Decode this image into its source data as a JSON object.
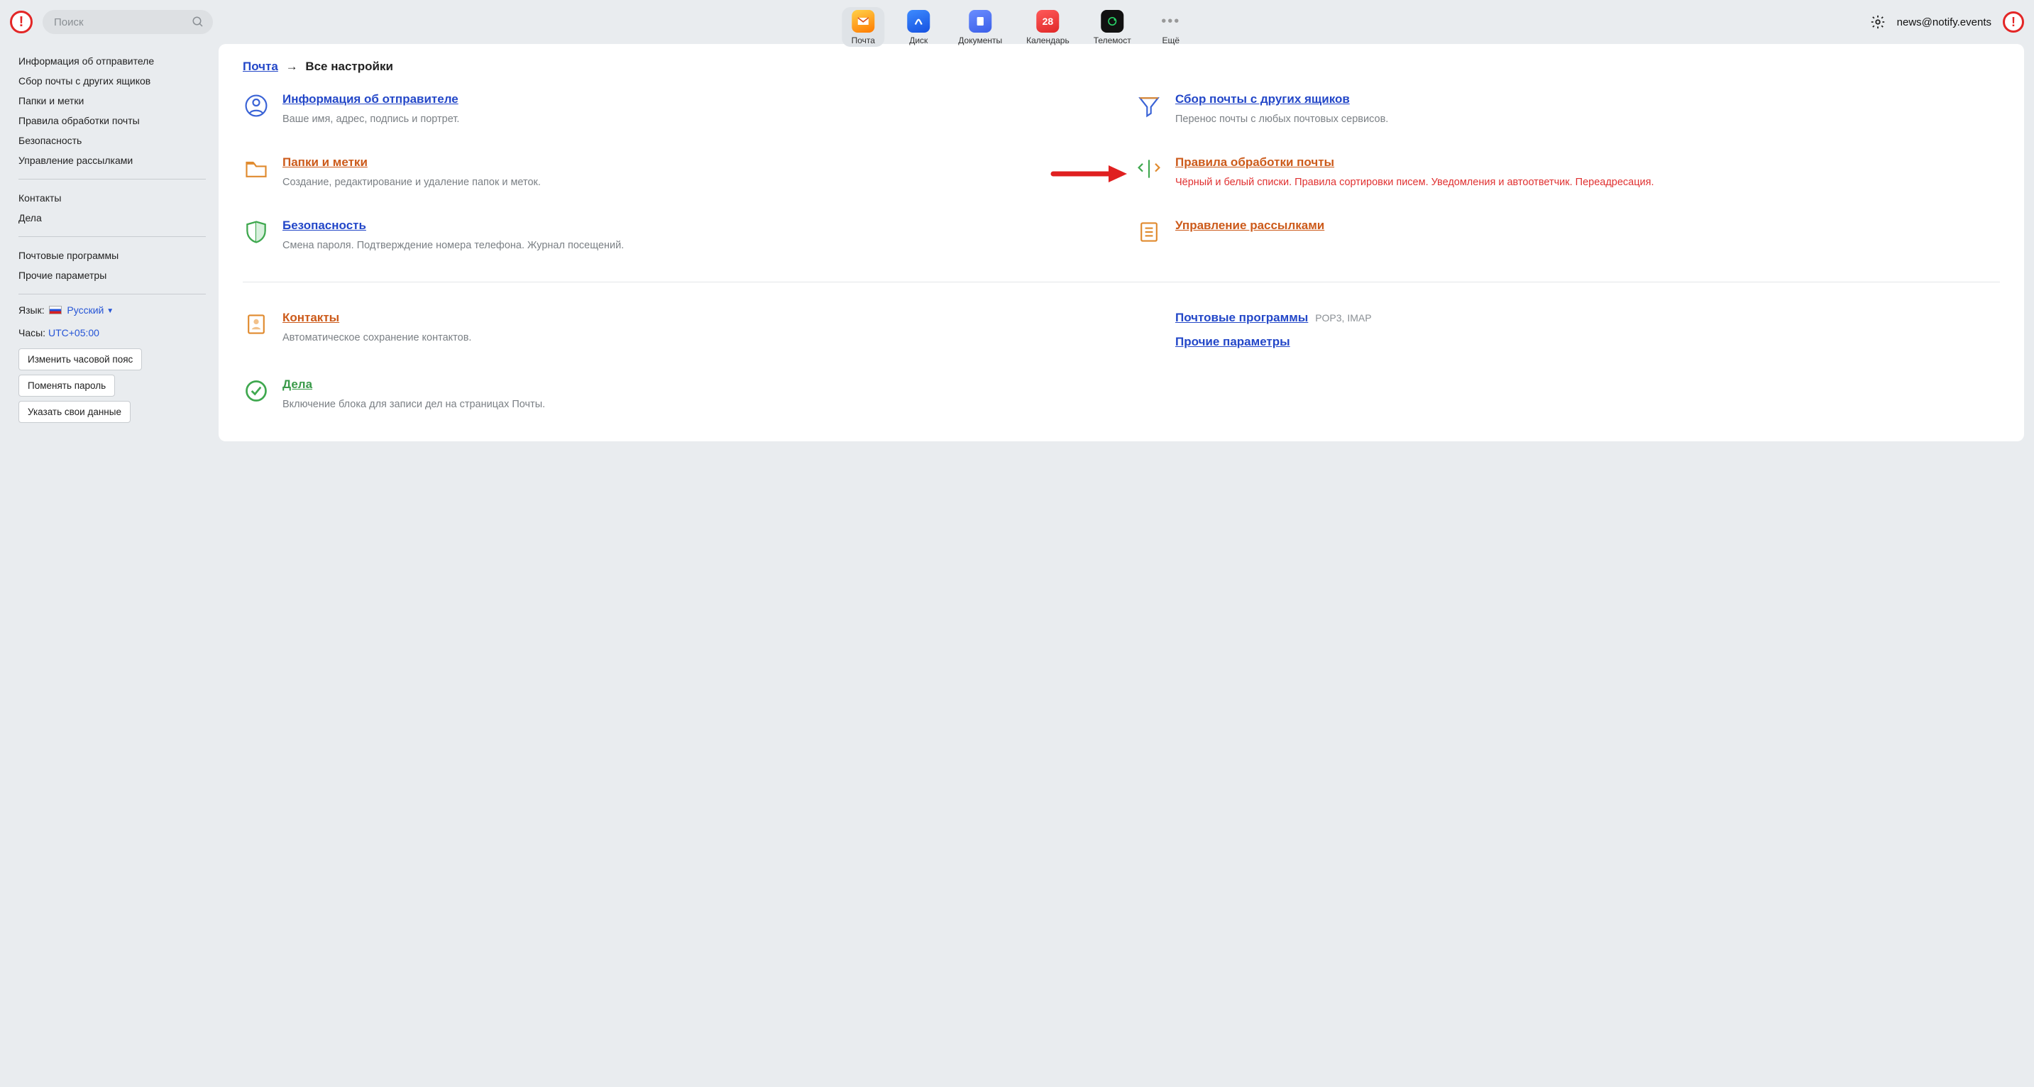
{
  "header": {
    "search_placeholder": "Поиск",
    "apps": [
      {
        "label": "Почта",
        "color": "#ffb300",
        "active": true,
        "icon": "mail"
      },
      {
        "label": "Диск",
        "color": "#2f6df6",
        "active": false,
        "icon": "disk"
      },
      {
        "label": "Документы",
        "color": "#4e7cff",
        "active": false,
        "icon": "docs"
      },
      {
        "label": "Календарь",
        "color": "#e63e3e",
        "active": false,
        "icon": "calendar",
        "badge": "28"
      },
      {
        "label": "Телемост",
        "color": "#1a1a1a",
        "active": false,
        "icon": "telemost"
      },
      {
        "label": "Ещё",
        "color": "",
        "active": false,
        "icon": "more"
      }
    ],
    "user_email": "news@notify.events"
  },
  "sidebar": {
    "group1": [
      "Информация об отправителе",
      "Сбор почты с других ящиков",
      "Папки и метки",
      "Правила обработки почты",
      "Безопасность",
      "Управление рассылками"
    ],
    "group2": [
      "Контакты",
      "Дела"
    ],
    "group3": [
      "Почтовые программы",
      "Прочие параметры"
    ],
    "lang_label": "Язык:",
    "lang_value": "Русский",
    "tz_label": "Часы:",
    "tz_value": "UTC+05:00",
    "buttons": [
      "Изменить часовой пояс",
      "Поменять пароль",
      "Указать свои данные"
    ]
  },
  "main": {
    "breadcrumb_root": "Почта",
    "breadcrumb_current": "Все настройки",
    "cards": {
      "sender": {
        "title": "Информация об отправителе",
        "desc": "Ваше имя, адрес, подпись и портрет."
      },
      "collect": {
        "title": "Сбор почты с других ящиков",
        "desc": "Перенос почты с любых почтовых сервисов."
      },
      "folders": {
        "title": "Папки и метки",
        "desc": "Создание, редактирование и удаление папок и меток."
      },
      "rules": {
        "title": "Правила обработки почты",
        "desc": "Чёрный и белый списки. Правила сортировки писем. Уведомления и автоответчик. Переадресация."
      },
      "security": {
        "title": "Безопасность",
        "desc": "Смена пароля. Подтверждение номера телефона. Журнал посещений."
      },
      "subs": {
        "title": "Управление рассылками"
      },
      "contacts": {
        "title": "Контакты",
        "desc": "Автоматическое сохранение контактов."
      },
      "clients": {
        "title": "Почтовые программы",
        "note": "POP3, IMAP"
      },
      "other": {
        "title": "Прочие параметры"
      },
      "todo": {
        "title": "Дела",
        "desc": "Включение блока для записи дел на страницах Почты."
      }
    }
  }
}
